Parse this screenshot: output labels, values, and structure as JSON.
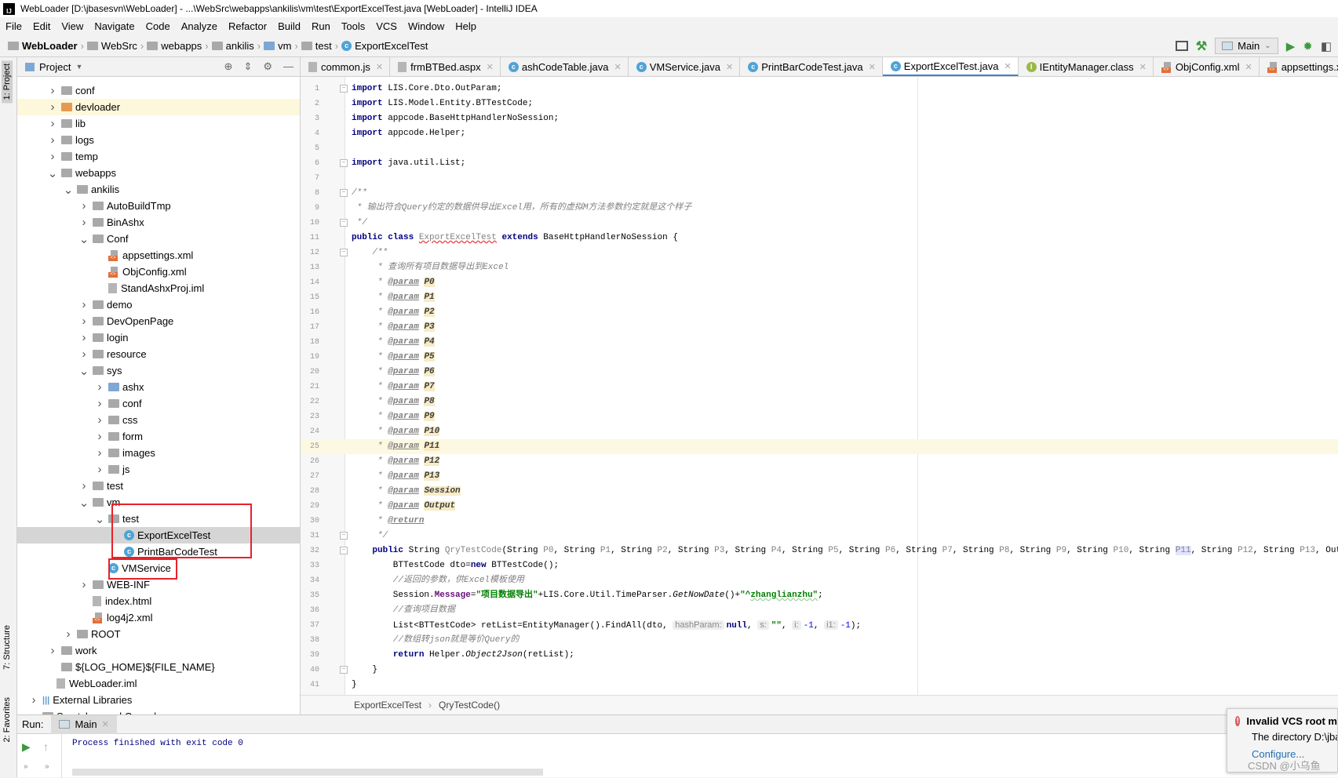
{
  "window": {
    "title": "WebLoader [D:\\jbasesvn\\WebLoader] - ...\\WebSrc\\webapps\\ankilis\\vm\\test\\ExportExcelTest.java [WebLoader] - IntelliJ IDEA"
  },
  "menu": [
    "File",
    "Edit",
    "View",
    "Navigate",
    "Code",
    "Analyze",
    "Refactor",
    "Build",
    "Run",
    "Tools",
    "VCS",
    "Window",
    "Help"
  ],
  "breadcrumbs": [
    "WebLoader",
    "WebSrc",
    "webapps",
    "ankilis",
    "vm",
    "test",
    "ExportExcelTest"
  ],
  "toolbar": {
    "run_config": "Main",
    "icons": [
      "layout-icon",
      "build-hammer-icon",
      "run-icon",
      "debug-icon",
      "coverage-icon"
    ]
  },
  "side_tabs": {
    "project": "1: Project",
    "structure": "7: Structure",
    "favorites": "2: Favorites"
  },
  "project_panel": {
    "title": "Project",
    "tree": [
      {
        "label": "conf",
        "level": 0,
        "type": "folder",
        "arrow": "right"
      },
      {
        "label": "devloader",
        "level": 0,
        "type": "folder-excluded",
        "arrow": "right",
        "highlight": true
      },
      {
        "label": "lib",
        "level": 0,
        "type": "folder",
        "arrow": "right"
      },
      {
        "label": "logs",
        "level": 0,
        "type": "folder",
        "arrow": "right"
      },
      {
        "label": "temp",
        "level": 0,
        "type": "folder",
        "arrow": "right"
      },
      {
        "label": "webapps",
        "level": 0,
        "type": "folder",
        "arrow": "down"
      },
      {
        "label": "ankilis",
        "level": 1,
        "type": "folder",
        "arrow": "down"
      },
      {
        "label": "AutoBuildTmp",
        "level": 2,
        "type": "folder",
        "arrow": "right"
      },
      {
        "label": "BinAshx",
        "level": 2,
        "type": "folder",
        "arrow": "right"
      },
      {
        "label": "Conf",
        "level": 2,
        "type": "folder",
        "arrow": "down"
      },
      {
        "label": "appsettings.xml",
        "level": 3,
        "type": "xml"
      },
      {
        "label": "ObjConfig.xml",
        "level": 3,
        "type": "xml"
      },
      {
        "label": "StandAshxProj.iml",
        "level": 3,
        "type": "file"
      },
      {
        "label": "demo",
        "level": 2,
        "type": "folder",
        "arrow": "right"
      },
      {
        "label": "DevOpenPage",
        "level": 2,
        "type": "folder",
        "arrow": "right"
      },
      {
        "label": "login",
        "level": 2,
        "type": "folder",
        "arrow": "right"
      },
      {
        "label": "resource",
        "level": 2,
        "type": "folder",
        "arrow": "right"
      },
      {
        "label": "sys",
        "level": 2,
        "type": "folder",
        "arrow": "down"
      },
      {
        "label": "ashx",
        "level": 3,
        "type": "folder-blue",
        "arrow": "right"
      },
      {
        "label": "conf",
        "level": 3,
        "type": "folder",
        "arrow": "right"
      },
      {
        "label": "css",
        "level": 3,
        "type": "folder",
        "arrow": "right"
      },
      {
        "label": "form",
        "level": 3,
        "type": "folder",
        "arrow": "right"
      },
      {
        "label": "images",
        "level": 3,
        "type": "folder",
        "arrow": "right"
      },
      {
        "label": "js",
        "level": 3,
        "type": "folder",
        "arrow": "right"
      },
      {
        "label": "test",
        "level": 2,
        "type": "folder",
        "arrow": "right"
      },
      {
        "label": "vm",
        "level": 2,
        "type": "folder",
        "arrow": "down"
      },
      {
        "label": "test",
        "level": 3,
        "type": "folder",
        "arrow": "down"
      },
      {
        "label": "ExportExcelTest",
        "level": 4,
        "type": "class",
        "selected": true
      },
      {
        "label": "PrintBarCodeTest",
        "level": 4,
        "type": "class"
      },
      {
        "label": "VMService",
        "level": 3,
        "type": "class"
      },
      {
        "label": "WEB-INF",
        "level": 2,
        "type": "folder",
        "arrow": "right"
      },
      {
        "label": "index.html",
        "level": 2,
        "type": "file"
      },
      {
        "label": "log4j2.xml",
        "level": 2,
        "type": "xml"
      },
      {
        "label": "ROOT",
        "level": 1,
        "type": "folder",
        "arrow": "right"
      },
      {
        "label": "work",
        "level": 0,
        "type": "folder",
        "arrow": "right"
      },
      {
        "label": "${LOG_HOME}${FILE_NAME}",
        "level": 0,
        "type": "folder"
      },
      {
        "label": "WebLoader.iml",
        "level": -0.3,
        "type": "file"
      },
      {
        "label": "External Libraries",
        "level": -1.2,
        "type": "library",
        "arrow": "right"
      },
      {
        "label": "Scratches and Consoles",
        "level": -1.2,
        "type": "folder"
      }
    ]
  },
  "tabs": [
    {
      "label": "common.js",
      "icon": "file"
    },
    {
      "label": "frmBTBed.aspx",
      "icon": "file"
    },
    {
      "label": "ashCodeTable.java",
      "icon": "class"
    },
    {
      "label": "VMService.java",
      "icon": "class"
    },
    {
      "label": "PrintBarCodeTest.java",
      "icon": "class"
    },
    {
      "label": "ExportExcelTest.java",
      "icon": "class",
      "active": true
    },
    {
      "label": "IEntityManager.class",
      "icon": "interface"
    },
    {
      "label": "ObjConfig.xml",
      "icon": "xml"
    },
    {
      "label": "appsettings.xml",
      "icon": "xml"
    }
  ],
  "editor": {
    "current_line": 25,
    "fold_lines": [
      1,
      6,
      8,
      10,
      12,
      31,
      32,
      40
    ],
    "lines": [
      [
        [
          "import",
          "k"
        ],
        [
          " LIS.Core.Dto.OutParam;",
          ""
        ]
      ],
      [
        [
          "import",
          "k"
        ],
        [
          " LIS.Model.Entity.BTTestCode;",
          ""
        ]
      ],
      [
        [
          "import",
          "k"
        ],
        [
          " appcode.BaseHttpHandlerNoSession;",
          ""
        ]
      ],
      [
        [
          "import",
          "k"
        ],
        [
          " appcode.Helper;",
          ""
        ]
      ],
      [],
      [
        [
          "import",
          "k"
        ],
        [
          " java.util.List;",
          ""
        ]
      ],
      [],
      [
        [
          "/**",
          "c"
        ]
      ],
      [
        [
          " * 输出符合Query约定的数据供导出Excel用，所有的虚拟M方法参数约定就是这个样子",
          "c"
        ]
      ],
      [
        [
          " */",
          "c"
        ]
      ],
      [
        [
          "public class",
          "k"
        ],
        [
          " ",
          ""
        ],
        [
          "ExportExcelTest",
          "err"
        ],
        [
          " ",
          ""
        ],
        [
          "extends",
          "k"
        ],
        [
          " BaseHttpHandlerNoSession {",
          ""
        ]
      ],
      [
        [
          "    /**",
          "c"
        ]
      ],
      [
        [
          "     * 查询所有项目数据导出到Excel",
          "c"
        ]
      ],
      [
        [
          "     * ",
          "c"
        ],
        [
          "@param",
          "tag"
        ],
        [
          " ",
          ""
        ],
        [
          "P0",
          "pv"
        ]
      ],
      [
        [
          "     * ",
          "c"
        ],
        [
          "@param",
          "tag"
        ],
        [
          " ",
          ""
        ],
        [
          "P1",
          "pv"
        ]
      ],
      [
        [
          "     * ",
          "c"
        ],
        [
          "@param",
          "tag"
        ],
        [
          " ",
          ""
        ],
        [
          "P2",
          "pv"
        ]
      ],
      [
        [
          "     * ",
          "c"
        ],
        [
          "@param",
          "tag"
        ],
        [
          " ",
          ""
        ],
        [
          "P3",
          "pv"
        ]
      ],
      [
        [
          "     * ",
          "c"
        ],
        [
          "@param",
          "tag"
        ],
        [
          " ",
          ""
        ],
        [
          "P4",
          "pv"
        ]
      ],
      [
        [
          "     * ",
          "c"
        ],
        [
          "@param",
          "tag"
        ],
        [
          " ",
          ""
        ],
        [
          "P5",
          "pv"
        ]
      ],
      [
        [
          "     * ",
          "c"
        ],
        [
          "@param",
          "tag"
        ],
        [
          " ",
          ""
        ],
        [
          "P6",
          "pv"
        ]
      ],
      [
        [
          "     * ",
          "c"
        ],
        [
          "@param",
          "tag"
        ],
        [
          " ",
          ""
        ],
        [
          "P7",
          "pv"
        ]
      ],
      [
        [
          "     * ",
          "c"
        ],
        [
          "@param",
          "tag"
        ],
        [
          " ",
          ""
        ],
        [
          "P8",
          "pv"
        ]
      ],
      [
        [
          "     * ",
          "c"
        ],
        [
          "@param",
          "tag"
        ],
        [
          " ",
          ""
        ],
        [
          "P9",
          "pv"
        ]
      ],
      [
        [
          "     * ",
          "c"
        ],
        [
          "@param",
          "tag"
        ],
        [
          " ",
          ""
        ],
        [
          "P10",
          "pv"
        ]
      ],
      [
        [
          "     * ",
          "c"
        ],
        [
          "@param",
          "tag"
        ],
        [
          " ",
          ""
        ],
        [
          "P11",
          "pv"
        ]
      ],
      [
        [
          "     * ",
          "c"
        ],
        [
          "@param",
          "tag"
        ],
        [
          " ",
          ""
        ],
        [
          "P12",
          "pv"
        ]
      ],
      [
        [
          "     * ",
          "c"
        ],
        [
          "@param",
          "tag"
        ],
        [
          " ",
          ""
        ],
        [
          "P13",
          "pv"
        ]
      ],
      [
        [
          "     * ",
          "c"
        ],
        [
          "@param",
          "tag"
        ],
        [
          " ",
          ""
        ],
        [
          "Session",
          "pv"
        ]
      ],
      [
        [
          "     * ",
          "c"
        ],
        [
          "@param",
          "tag"
        ],
        [
          " ",
          ""
        ],
        [
          "Output",
          "pv"
        ]
      ],
      [
        [
          "     * ",
          "c"
        ],
        [
          "@return",
          "tag"
        ]
      ],
      [
        [
          "     */",
          "c"
        ]
      ],
      [
        [
          "    ",
          ""
        ],
        [
          "public",
          "k"
        ],
        [
          " String ",
          ""
        ],
        [
          "QryTestCode",
          "u"
        ],
        [
          "(String ",
          ""
        ],
        [
          "P0",
          "u"
        ],
        [
          ", String ",
          ""
        ],
        [
          "P1",
          "u"
        ],
        [
          ", String ",
          ""
        ],
        [
          "P2",
          "u"
        ],
        [
          ", String ",
          ""
        ],
        [
          "P3",
          "u"
        ],
        [
          ", String ",
          ""
        ],
        [
          "P4",
          "u"
        ],
        [
          ", String ",
          ""
        ],
        [
          "P5",
          "u"
        ],
        [
          ", String ",
          ""
        ],
        [
          "P6",
          "u"
        ],
        [
          ", String ",
          ""
        ],
        [
          "P7",
          "u"
        ],
        [
          ", String ",
          ""
        ],
        [
          "P8",
          "u"
        ],
        [
          ", String ",
          ""
        ],
        [
          "P9",
          "u"
        ],
        [
          ", String ",
          ""
        ],
        [
          "P10",
          "u"
        ],
        [
          ", String ",
          ""
        ],
        [
          "P11",
          "u hl11"
        ],
        [
          ", String ",
          ""
        ],
        [
          "P12",
          "u"
        ],
        [
          ", String ",
          ""
        ],
        [
          "P13",
          "u"
        ],
        [
          ", OutParam Session, OutParam Output) {",
          ""
        ]
      ],
      [
        [
          "        BTTestCode dto=",
          ""
        ],
        [
          "new",
          "k"
        ],
        [
          " BTTestCode();",
          ""
        ]
      ],
      [
        [
          "        //返回的参数，供Excel模板使用",
          "c"
        ]
      ],
      [
        [
          "        Session.",
          ""
        ],
        [
          "Message",
          "f"
        ],
        [
          "=",
          ""
        ],
        [
          "\"项目数据导出\"",
          "s"
        ],
        [
          "+LIS.Core.Util.TimeParser.",
          ""
        ],
        [
          "GetNowDate",
          "it"
        ],
        [
          "()+",
          ""
        ],
        [
          "\"^",
          "s"
        ],
        [
          "zhanglianzhu\"",
          "s sq"
        ],
        [
          ";",
          ""
        ]
      ],
      [
        [
          "        //查询项目数据",
          "c"
        ]
      ],
      [
        [
          "        List<BTTestCode> retList=EntityManager().FindAll(dto, ",
          ""
        ],
        [
          "hashParam:",
          "h"
        ],
        [
          "null",
          "k"
        ],
        [
          ", ",
          ""
        ],
        [
          "s:",
          "h"
        ],
        [
          "\"\"",
          "s"
        ],
        [
          ", ",
          ""
        ],
        [
          "i:",
          "h"
        ],
        [
          "-1",
          "n"
        ],
        [
          ", ",
          ""
        ],
        [
          "i1:",
          "h"
        ],
        [
          "-1",
          "n"
        ],
        [
          ");",
          ""
        ]
      ],
      [
        [
          "        //数组转json就是等价Query的",
          "c"
        ]
      ],
      [
        [
          "        ",
          ""
        ],
        [
          "return",
          "k"
        ],
        [
          " Helper.",
          ""
        ],
        [
          "Object2Json",
          "it"
        ],
        [
          "(retList);",
          ""
        ]
      ],
      [
        [
          "    }",
          ""
        ]
      ],
      [
        [
          "}",
          ""
        ]
      ]
    ],
    "breadcrumb": [
      "ExportExcelTest",
      "QryTestCode()"
    ]
  },
  "run_panel": {
    "label": "Run:",
    "tab": "Main",
    "output": "Process finished with exit code 0"
  },
  "notification": {
    "title": "Invalid VCS root m",
    "body": "The directory D:\\jba",
    "link": "Configure..."
  },
  "watermark": "CSDN @小乌鱼"
}
